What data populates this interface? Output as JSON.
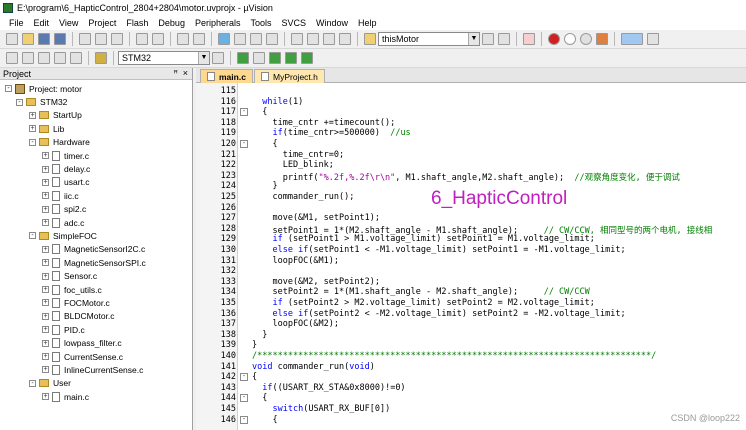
{
  "window": {
    "title": "E:\\program\\6_HapticControl_2804+2804\\motor.uvprojx - µVision"
  },
  "menu": [
    "File",
    "Edit",
    "View",
    "Project",
    "Flash",
    "Debug",
    "Peripherals",
    "Tools",
    "SVCS",
    "Window",
    "Help"
  ],
  "toolbar": {
    "target_combo": "thisMotor",
    "target_select": "STM32"
  },
  "project_panel": {
    "title": "Project",
    "pin": "ꟸ",
    "close": "×",
    "root": "Project: motor",
    "target": "STM32",
    "groups": [
      {
        "name": "StartUp",
        "expanded": false,
        "files": []
      },
      {
        "name": "Lib",
        "expanded": false,
        "files": []
      },
      {
        "name": "Hardware",
        "expanded": true,
        "files": [
          "timer.c",
          "delay.c",
          "usart.c",
          "iic.c",
          "spi2.c",
          "adc.c"
        ]
      },
      {
        "name": "SimpleFOC",
        "expanded": true,
        "files": [
          "MagneticSensorI2C.c",
          "MagneticSensorSPI.c",
          "Sensor.c",
          "foc_utils.c",
          "FOCMotor.c",
          "BLDCMotor.c",
          "PID.c",
          "lowpass_filter.c",
          "CurrentSense.c",
          "InlineCurrentSense.c"
        ]
      },
      {
        "name": "User",
        "expanded": true,
        "files": [
          "main.c"
        ]
      }
    ]
  },
  "tabs": [
    {
      "label": "main.c",
      "active": true
    },
    {
      "label": "MyProject.h",
      "active": false
    }
  ],
  "editor": {
    "lines": [
      {
        "n": "115",
        "code": ""
      },
      {
        "n": "116",
        "code": "  while(1)"
      },
      {
        "n": "117",
        "code": "  {",
        "fold": "-"
      },
      {
        "n": "118",
        "code": "    time_cntr +=timecount();"
      },
      {
        "n": "119",
        "code": "    if(time_cntr>=500000)  //us"
      },
      {
        "n": "120",
        "code": "    {",
        "fold": "-"
      },
      {
        "n": "121",
        "code": "      time_cntr=0;"
      },
      {
        "n": "122",
        "code": "      LED_blink;"
      },
      {
        "n": "123",
        "code": "      printf(\"%.2f,%.2f\\r\\n\", M1.shaft_angle,M2.shaft_angle);  //观察角度变化, 便于调试"
      },
      {
        "n": "124",
        "code": "    }"
      },
      {
        "n": "125",
        "code": "    commander_run();"
      },
      {
        "n": "126",
        "code": ""
      },
      {
        "n": "127",
        "code": "    move(&M1, setPoint1);"
      },
      {
        "n": "128",
        "code": "    setPoint1 = 1*(M2.shaft_angle - M1.shaft_angle);     // CW/CCW, 相同型号的两个电机, 接线相"
      },
      {
        "n": "129",
        "code": "    if (setPoint1 > M1.voltage_limit) setPoint1 = M1.voltage_limit;"
      },
      {
        "n": "130",
        "code": "    else if(setPoint1 < -M1.voltage_limit) setPoint1 = -M1.voltage_limit;"
      },
      {
        "n": "131",
        "code": "    loopFOC(&M1);"
      },
      {
        "n": "132",
        "code": ""
      },
      {
        "n": "133",
        "code": "    move(&M2, setPoint2);"
      },
      {
        "n": "134",
        "code": "    setPoint2 = 1*(M1.shaft_angle - M2.shaft_angle);     // CW/CCW"
      },
      {
        "n": "135",
        "code": "    if (setPoint2 > M2.voltage_limit) setPoint2 = M2.voltage_limit;"
      },
      {
        "n": "136",
        "code": "    else if(setPoint2 < -M2.voltage_limit) setPoint2 = -M2.voltage_limit;"
      },
      {
        "n": "137",
        "code": "    loopFOC(&M2);"
      },
      {
        "n": "138",
        "code": "  }"
      },
      {
        "n": "139",
        "code": "}"
      },
      {
        "n": "140",
        "code": "/*****************************************************************************/"
      },
      {
        "n": "141",
        "code": "void commander_run(void)"
      },
      {
        "n": "142",
        "code": "{",
        "fold": "-"
      },
      {
        "n": "143",
        "code": "  if((USART_RX_STA&0x8000)!=0)"
      },
      {
        "n": "144",
        "code": "  {",
        "fold": "-"
      },
      {
        "n": "145",
        "code": "    switch(USART_RX_BUF[0])"
      },
      {
        "n": "146",
        "code": "    {",
        "fold": "-"
      }
    ]
  },
  "overlay_text": "6_HapticControl",
  "watermark": "CSDN @loop222"
}
